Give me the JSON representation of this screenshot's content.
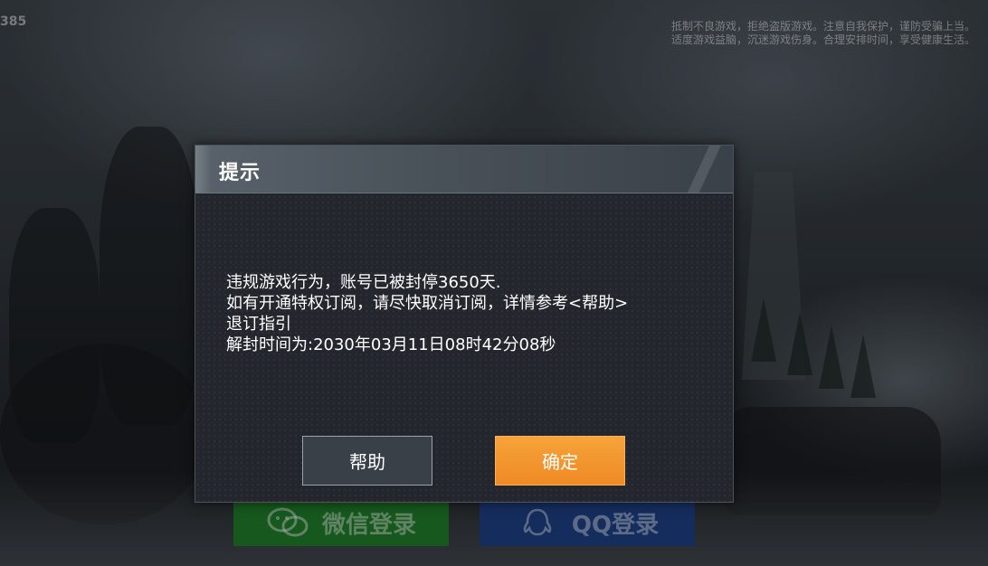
{
  "screen": {
    "corner_number": "385",
    "notice": {
      "line1": "抵制不良游戏，拒绝盗版游戏。注意自我保护，谨防受骗上当。",
      "line2": "适度游戏益脑，沉迷游戏伤身。合理安排时间，享受健康生活。"
    }
  },
  "login": {
    "wechat_label": "微信登录",
    "qq_label": "QQ登录",
    "wechat_icon": "wechat-icon",
    "qq_icon": "qq-penguin-icon"
  },
  "dialog": {
    "title": "提示",
    "message": {
      "line1": "违规游戏行为，账号已被封停3650天.",
      "line2": "如有开通特权订阅，请尽快取消订阅，详情参考<帮助>",
      "line3": "退订指引",
      "line4": "解封时间为:2030年03月11日08时42分08秒"
    },
    "buttons": {
      "help_label": "帮助",
      "ok_label": "确定"
    },
    "colors": {
      "ok_button": "#f08a23",
      "help_button": "#3a4048",
      "header": "#4a525a"
    }
  }
}
